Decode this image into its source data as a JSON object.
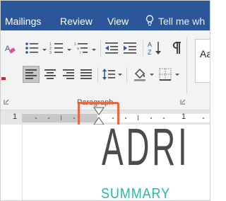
{
  "tabs": {
    "mailings": "Mailings",
    "review": "Review",
    "view": "View"
  },
  "tell_me": "Tell me wh",
  "ribbon": {
    "group_label": "Paragraph",
    "styles_preview": "Aa",
    "icons": [
      "font-color-eraser-icon",
      "bullets-icon",
      "numbering-icon",
      "multilevel-list-icon",
      "decrease-indent-icon",
      "increase-indent-icon",
      "sort-icon",
      "show-formatting-marks-icon",
      "align-left-icon",
      "center-icon",
      "align-right-icon",
      "justify-icon",
      "line-spacing-icon",
      "shading-icon",
      "borders-icon"
    ]
  },
  "ruler": {
    "left_number": "1",
    "right_number": "1"
  },
  "document": {
    "title": "ADRI",
    "subtitle": "SUMMARY"
  },
  "colors": {
    "tab_bar": "#2b579a",
    "highlight": "#e86a40",
    "subtitle": "#2fb7a4",
    "title": "#4b4b4b"
  }
}
